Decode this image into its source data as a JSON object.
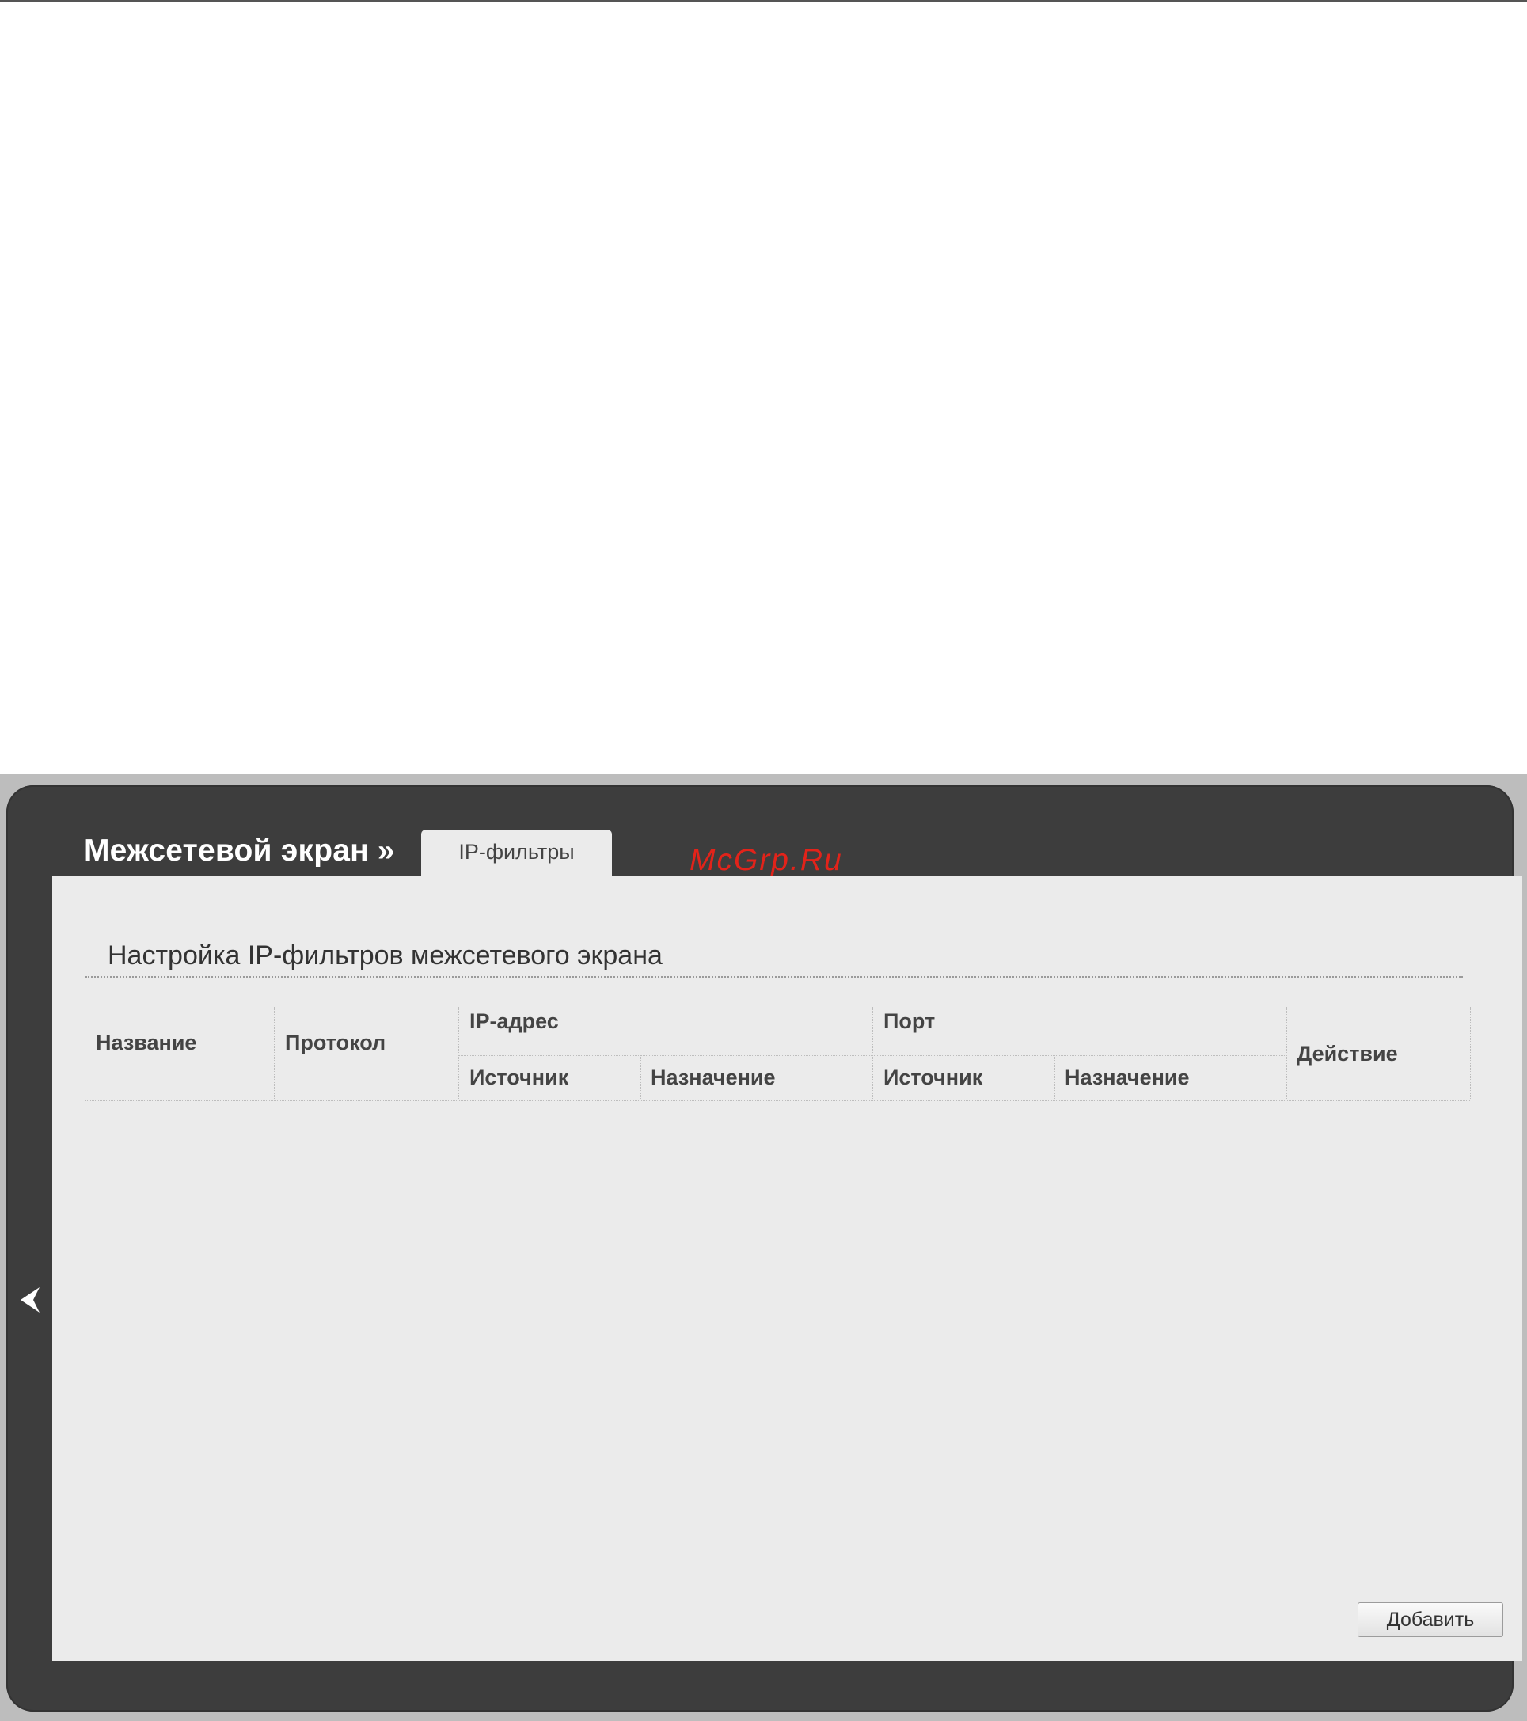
{
  "breadcrumb": {
    "section": "Межсетевой экран »"
  },
  "tabs": [
    {
      "label": "IP-фильтры",
      "active": true
    }
  ],
  "watermark": "McGrp.Ru",
  "main": {
    "title": "Настройка IP-фильтров межсетевого экрана",
    "table": {
      "headers": {
        "name": "Название",
        "protocol": "Протокол",
        "ip_address": "IP-адрес",
        "ip_source": "Источник",
        "ip_destination": "Назначение",
        "port": "Порт",
        "port_source": "Источник",
        "port_destination": "Назначение",
        "action": "Действие"
      },
      "rows": []
    },
    "add_button": "Добавить"
  },
  "colors": {
    "frame": "#3d3d3d",
    "panel": "#ebebeb",
    "watermark": "#e2231a"
  },
  "icons": {
    "back": "chevron-left-icon"
  }
}
